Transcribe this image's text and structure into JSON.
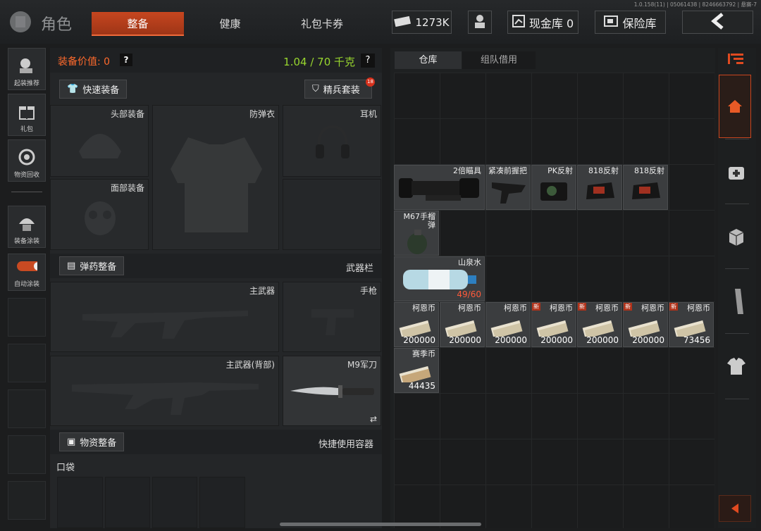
{
  "version": "1.0.158(11) | 05061438 | 8246663792 | 悬赛-7",
  "header": {
    "title": "角色",
    "tabs": [
      "整备",
      "健康",
      "礼包卡券"
    ],
    "currency": "1273K",
    "vault": "现金库 0",
    "insurance": "保险库"
  },
  "sidebar": {
    "items": [
      "起装推荐",
      "礼包",
      "物资回收",
      "装备涂装",
      "自动涂装"
    ]
  },
  "equip": {
    "value_label": "装备价值: 0",
    "help": "?",
    "weight": "1.04 / 70 千克",
    "quick_equip": "快速装备",
    "elite_set": "精兵套装",
    "elite_badge": "18",
    "slots": {
      "head": "头部装备",
      "armor": "防弹衣",
      "headset": "耳机",
      "face": "面部装备"
    },
    "ammo_btn": "弹药整备",
    "weapons_hdr": "武器栏",
    "primary": "主武器",
    "pistol": "手枪",
    "primary_back": "主武器(背部)",
    "knife": "M9军刀",
    "knife_swap": "⇄",
    "supply_btn": "物资整备",
    "quick_container": "快捷使用容器",
    "pocket": "口袋"
  },
  "inventory": {
    "tabs": [
      "仓库",
      "组队借用"
    ],
    "items": {
      "scope": "2倍瞄具",
      "grip": "紧凑前握把",
      "pk": "PK反射",
      "r818a": "818反射",
      "r818b": "818反射",
      "grenade": "M67手榴弹",
      "water": "山泉水",
      "water_qty": "49/60",
      "coin_name": "柯恩币",
      "coin_qty": [
        "200000",
        "200000",
        "200000",
        "200000",
        "200000",
        "200000",
        "73456"
      ],
      "new_tag": "新",
      "season_name": "赛季币",
      "season_qty": "44435"
    }
  },
  "colors": {
    "accent": "#c6461f",
    "orange_text": "#ff6a2c",
    "green_text": "#98d62e",
    "red_qty": "#ff5a3a"
  }
}
